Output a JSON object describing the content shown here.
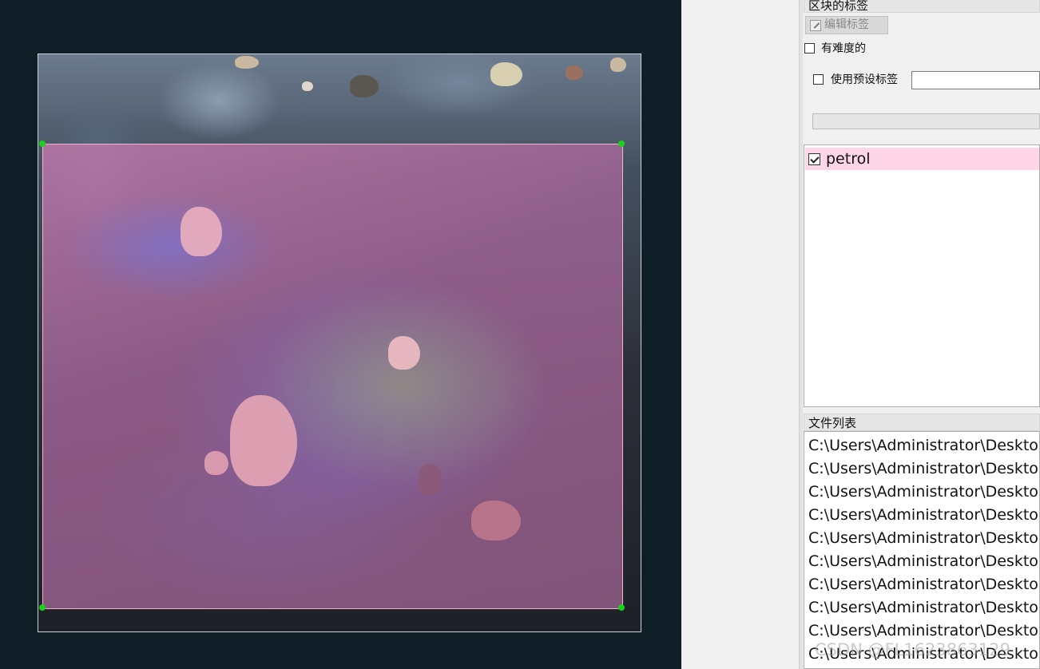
{
  "canvas": {
    "annotation_color": "#d77fb4",
    "handle_color": "#19d219"
  },
  "panel": {
    "box_labels_title": "区块的标签",
    "edit_label_button": "编辑标签",
    "difficult_label": "有难度的",
    "use_default_label": "使用预设标签",
    "default_label_value": "",
    "labels": [
      {
        "name": "petrol",
        "checked": true
      }
    ],
    "file_list_title": "文件列表",
    "files": [
      "C:\\Users\\Administrator\\Deskto",
      "C:\\Users\\Administrator\\Deskto",
      "C:\\Users\\Administrator\\Deskto",
      "C:\\Users\\Administrator\\Deskto",
      "C:\\Users\\Administrator\\Deskto",
      "C:\\Users\\Administrator\\Deskto",
      "C:\\Users\\Administrator\\Deskto",
      "C:\\Users\\Administrator\\Deskto",
      "C:\\Users\\Administrator\\Deskto",
      "C:\\Users\\Administrator\\Deskto"
    ]
  },
  "watermark": "CSDN @FL1623863129"
}
